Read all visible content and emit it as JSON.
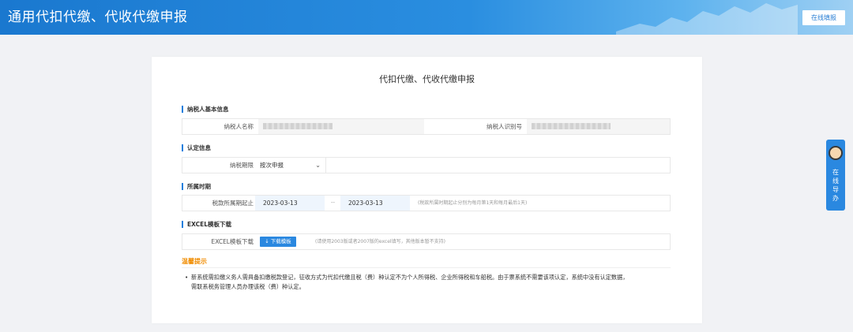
{
  "header": {
    "title": "通用代扣代缴、代收代缴申报",
    "online_btn": "在线填报"
  },
  "card": {
    "title": "代扣代缴、代收代缴申报",
    "sections": {
      "basic": "纳税人基本信息",
      "auth": "认定信息",
      "period": "所属时期",
      "excel": "EXCEL模板下载"
    },
    "basic": {
      "name_label": "纳税人名称",
      "id_label": "纳税人识别号"
    },
    "auth": {
      "period_label": "纳税期限",
      "period_value": "按次申报"
    },
    "period": {
      "label": "税款所属期起止",
      "start": "2023-03-13",
      "sep": "--",
      "end": "2023-03-13",
      "hint": "(税款所属时期起止分别为每月第1天和每月最后1天)"
    },
    "excel": {
      "label": "EXCEL模板下载",
      "button": "↓ 下载模板",
      "hint": "(请使用2003版或者2007版的excel填写，其他版本暂不支持)"
    },
    "tips": {
      "title": "温馨提示",
      "text_1": "新系统需扣缴义务人需具备扣缴税款登记，征收方式为代扣代缴且税（费）种认定不为个人所得税、企业所得税和车船税。由于票系统不需要该项认定，系统中没有认定数据，",
      "text_2": "需联系税务管理人员办理该税（费）种认定。"
    }
  },
  "side": {
    "label": "在线导办"
  }
}
